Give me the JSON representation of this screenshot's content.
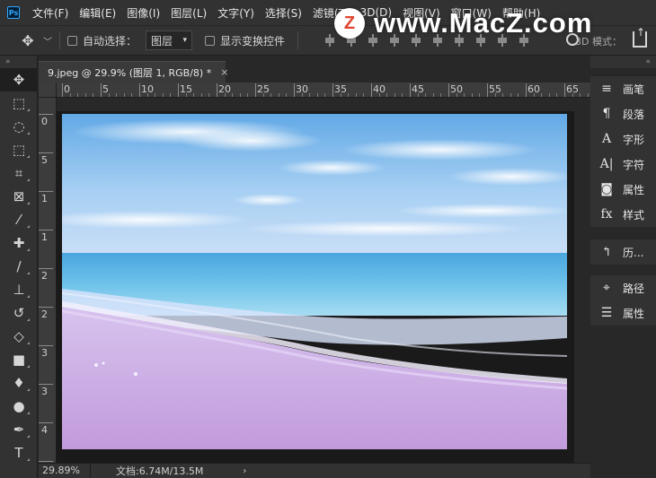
{
  "app": {
    "logo": "Ps"
  },
  "menu": [
    "文件(F)",
    "编辑(E)",
    "图像(I)",
    "图层(L)",
    "文字(Y)",
    "选择(S)",
    "滤镜(T)",
    "3D(D)",
    "视图(V)",
    "窗口(W)",
    "帮助(H)"
  ],
  "watermark": {
    "logo_letter": "Z",
    "text": "www.MacZ.com"
  },
  "options": {
    "auto_select_label": "自动选择：",
    "layer_select_value": "图层",
    "show_transform_label": "显示变换控件",
    "mode_label": "3D 模式："
  },
  "document": {
    "tab_title": "9.jpeg @ 29.9% (图层 1, RGB/8) *",
    "close_glyph": "×",
    "ruler_h": [
      "0",
      "5",
      "10",
      "15",
      "20",
      "25",
      "30",
      "35",
      "40",
      "45",
      "50",
      "55",
      "60",
      "65"
    ],
    "ruler_v": [
      "0",
      "5",
      "1",
      "1",
      "2",
      "2",
      "3",
      "3",
      "4",
      "4"
    ]
  },
  "status": {
    "zoom": "29.89%",
    "doc_info": "文档:6.74M/13.5M",
    "arrow": "›"
  },
  "tools": [
    {
      "name": "move-tool",
      "glyph": "✥"
    },
    {
      "name": "marquee-tool",
      "glyph": "⬚"
    },
    {
      "name": "lasso-tool",
      "glyph": "◌"
    },
    {
      "name": "object-select-tool",
      "glyph": "⬚"
    },
    {
      "name": "crop-tool",
      "glyph": "⌗"
    },
    {
      "name": "frame-tool",
      "glyph": "⊠"
    },
    {
      "name": "eyedropper-tool",
      "glyph": "⁄"
    },
    {
      "name": "healing-brush-tool",
      "glyph": "✚"
    },
    {
      "name": "brush-tool",
      "glyph": "∕"
    },
    {
      "name": "clone-stamp-tool",
      "glyph": "⊥"
    },
    {
      "name": "history-brush-tool",
      "glyph": "↺"
    },
    {
      "name": "eraser-tool",
      "glyph": "◇"
    },
    {
      "name": "gradient-tool",
      "glyph": "■"
    },
    {
      "name": "blur-tool",
      "glyph": "♦"
    },
    {
      "name": "dodge-tool",
      "glyph": "●"
    },
    {
      "name": "pen-tool",
      "glyph": "✒"
    },
    {
      "name": "type-tool",
      "glyph": "T"
    }
  ],
  "panels_group1": [
    {
      "name": "brush-panel",
      "icon": "≡",
      "label": "画笔"
    },
    {
      "name": "paragraph-panel",
      "icon": "¶",
      "label": "段落"
    },
    {
      "name": "glyphs-panel",
      "icon": "A",
      "label": "字形"
    },
    {
      "name": "character-panel",
      "icon": "A|",
      "label": "字符"
    },
    {
      "name": "properties-panel",
      "icon": "◙",
      "label": "属性"
    },
    {
      "name": "styles-panel",
      "icon": "fx",
      "label": "样式"
    }
  ],
  "panels_group2": [
    {
      "name": "history-panel",
      "icon": "↰",
      "label": "历..."
    }
  ],
  "panels_group3": [
    {
      "name": "paths-panel",
      "icon": "⌖",
      "label": "路径"
    },
    {
      "name": "adjustments-panel",
      "icon": "☰",
      "label": "属性"
    }
  ],
  "colors": {
    "sky_top": "#6fb4ea",
    "sky_mid": "#a9d1f3",
    "sea": "#5eb7e6",
    "foam": "#dfe3fb",
    "sand": "#c6a2dd"
  }
}
